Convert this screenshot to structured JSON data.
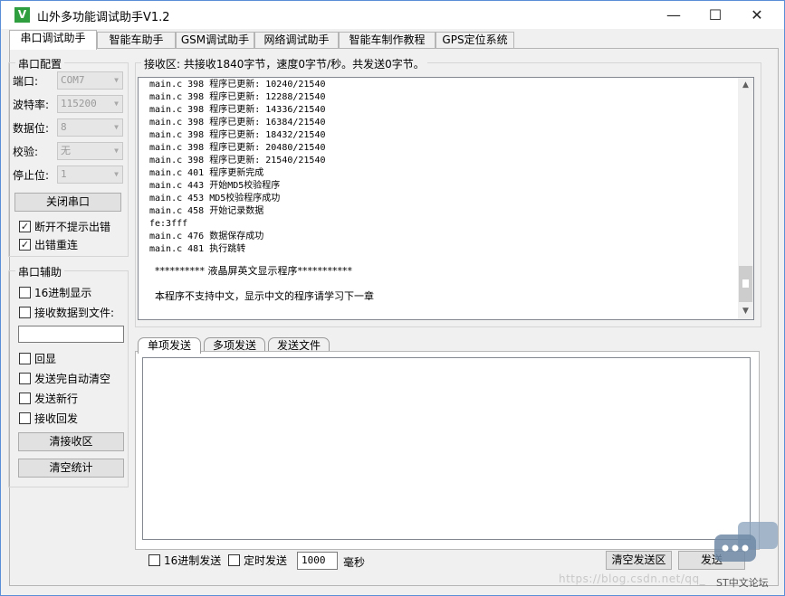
{
  "window": {
    "title": "山外多功能调试助手V1.2",
    "icon_name": "app-logo-icon",
    "icon_glyph": "V",
    "minimize_glyph": "—",
    "maximize_glyph": "☐",
    "close_glyph": "✕"
  },
  "tabs": [
    {
      "label": "串口调试助手",
      "active": true
    },
    {
      "label": "智能车助手",
      "active": false
    },
    {
      "label": "GSM调试助手",
      "active": false
    },
    {
      "label": "网络调试助手",
      "active": false
    },
    {
      "label": "智能车制作教程",
      "active": false
    },
    {
      "label": "GPS定位系统",
      "active": false
    }
  ],
  "serial_config": {
    "title": "串口配置",
    "port_label": "端口:",
    "port_value": "COM7",
    "baud_label": "波特率:",
    "baud_value": "115200",
    "databits_label": "数据位:",
    "databits_value": "8",
    "parity_label": "校验:",
    "parity_value": "无",
    "stopbits_label": "停止位:",
    "stopbits_value": "1",
    "close_port_button": "关闭串口",
    "no_prompt_on_disconnect": {
      "label": "断开不提示出错",
      "checked": true
    },
    "reconnect_on_error": {
      "label": "出错重连",
      "checked": true
    }
  },
  "serial_assist": {
    "title": "串口辅助",
    "hex_display": {
      "label": "16进制显示",
      "checked": false
    },
    "recv_to_file": {
      "label": "接收数据到文件:",
      "checked": false
    },
    "file_path": "",
    "echo": {
      "label": "回显",
      "checked": false
    },
    "auto_clear_after_send": {
      "label": "发送完自动清空",
      "checked": false
    },
    "send_newline": {
      "label": "发送新行",
      "checked": false
    },
    "recv_reply": {
      "label": "接收回发",
      "checked": false
    },
    "clear_recv_button": "清接收区",
    "clear_stats_button": "清空统计"
  },
  "receive": {
    "header": "接收区: 共接收1840字节，速度0字节/秒。共发送0字节。",
    "lines": [
      "main.c 398 程序已更新: 10240/21540",
      "main.c 398 程序已更新: 12288/21540",
      "main.c 398 程序已更新: 14336/21540",
      "main.c 398 程序已更新: 16384/21540",
      "main.c 398 程序已更新: 18432/21540",
      "main.c 398 程序已更新: 20480/21540",
      "main.c 398 程序已更新: 21540/21540",
      "main.c 401 程序更新完成",
      "main.c 443 开始MD5校验程序",
      "main.c 453 MD5校验程序成功",
      "main.c 458 开始记录数据",
      "fe:3fff",
      "main.c 476 数据保存成功",
      "main.c 481 执行跳转",
      "",
      "********** 液晶屏英文显示程序***********",
      "",
      "本程序不支持中文，显示中文的程序请学习下一章"
    ],
    "scroll_up_glyph": "▲",
    "scroll_down_glyph": "▼"
  },
  "send": {
    "tabs": [
      {
        "label": "单项发送",
        "active": true
      },
      {
        "label": "多项发送",
        "active": false
      },
      {
        "label": "发送文件",
        "active": false
      }
    ],
    "text": "",
    "hex_send": {
      "label": "16进制发送",
      "checked": false
    },
    "timed_send": {
      "label": "定时发送",
      "checked": false
    },
    "interval_value": "1000",
    "interval_unit": "毫秒",
    "clear_send_button": "清空发送区",
    "send_button": "发送"
  },
  "overlay": {
    "watermark": "https://blog.csdn.net/qq_",
    "forum_text": "ST中文论坛",
    "chat_icon_name": "chat-bubble-icon"
  }
}
